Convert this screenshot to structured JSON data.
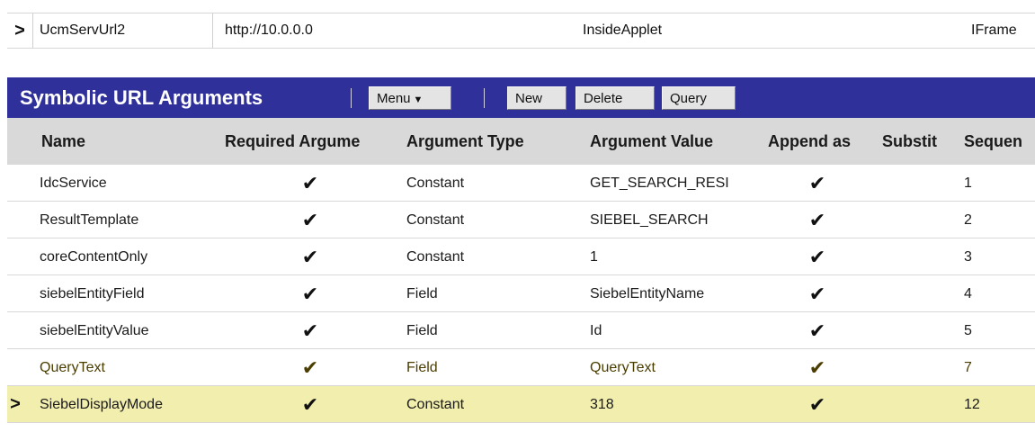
{
  "top_record": {
    "name": "UcmServUrl2",
    "url": "http://10.0.0.0",
    "location": "InsideApplet",
    "type": "IFrame"
  },
  "applet": {
    "title": "Symbolic URL Arguments",
    "separator": "|",
    "menu_label": "Menu",
    "new_label": "New",
    "delete_label": "Delete",
    "query_label": "Query"
  },
  "columns": [
    "Name",
    "Required Argume",
    "Argument Type",
    "Argument Value",
    "Append as",
    "Substit",
    "Sequen"
  ],
  "rows": [
    {
      "name": "IdcService",
      "required": "✔",
      "type": "Constant",
      "value": "GET_SEARCH_RESI",
      "append": "✔",
      "subst": "",
      "seq": "1"
    },
    {
      "name": "ResultTemplate",
      "required": "✔",
      "type": "Constant",
      "value": "SIEBEL_SEARCH",
      "append": "✔",
      "subst": "",
      "seq": "2"
    },
    {
      "name": "coreContentOnly",
      "required": "✔",
      "type": "Constant",
      "value": "1",
      "append": "✔",
      "subst": "",
      "seq": "3"
    },
    {
      "name": "siebelEntityField",
      "required": "✔",
      "type": "Field",
      "value": "SiebelEntityName",
      "append": "✔",
      "subst": "",
      "seq": "4"
    },
    {
      "name": "siebelEntityValue",
      "required": "✔",
      "type": "Field",
      "value": "Id",
      "append": "✔",
      "subst": "",
      "seq": "5"
    },
    {
      "name": "QueryText",
      "required": "✔",
      "type": "Field",
      "value": "QueryText",
      "append": "✔",
      "subst": "",
      "seq": "7"
    },
    {
      "name": "SiebelDisplayMode",
      "required": "✔",
      "type": "Constant",
      "value": "318",
      "append": "✔",
      "subst": "",
      "seq": "12"
    }
  ],
  "row_marker": ">",
  "colors": {
    "applet_bar": "#30309a",
    "header_bg": "#d9d9d9",
    "selected_row": "#f2eeae"
  }
}
